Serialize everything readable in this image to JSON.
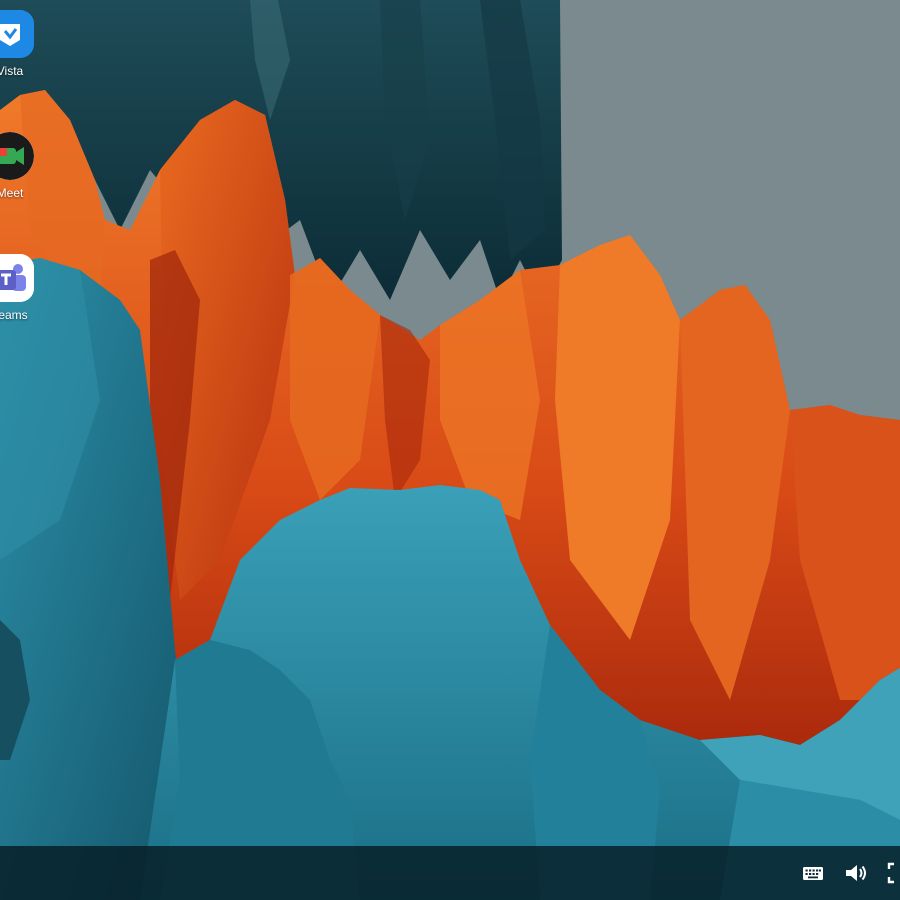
{
  "desktop": {
    "icons": [
      {
        "label": "Vista",
        "icon": "vista-app-icon",
        "color": "#1e88e5"
      },
      {
        "label": "Meet",
        "icon": "google-meet-icon",
        "color": "#34a853"
      },
      {
        "label": "Teams",
        "icon": "microsoft-teams-icon",
        "color": "#5b5fc7"
      }
    ]
  },
  "taskbar": {
    "tray": [
      {
        "icon": "keyboard-icon"
      },
      {
        "icon": "volume-icon"
      },
      {
        "icon": "screen-capture-icon"
      }
    ]
  },
  "colors": {
    "sky": "#7a8a8e",
    "teal": "#2a8aa3",
    "deep_teal": "#0f3a46",
    "orange": "#e8621c",
    "deep_orange": "#c2320f",
    "taskbar": "#061c24"
  }
}
